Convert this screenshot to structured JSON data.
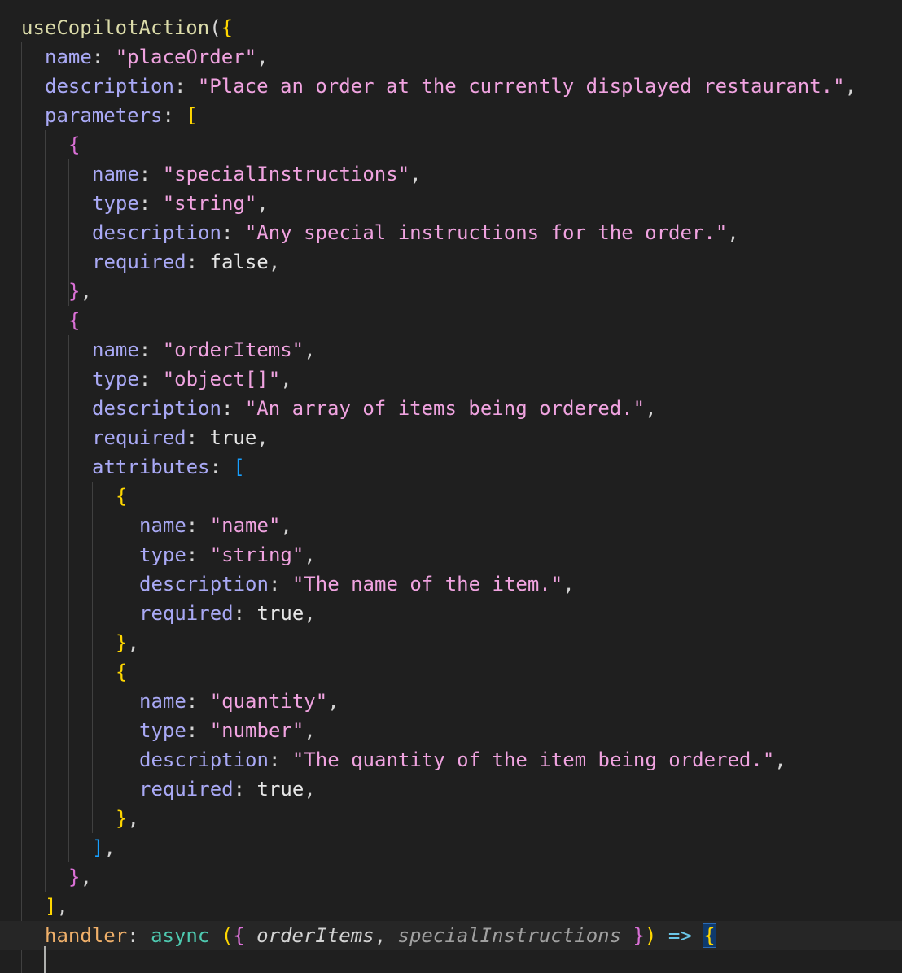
{
  "lines": [
    {
      "text": "useCopilotAction({"
    },
    {
      "text": "name: \"placeOrder\","
    },
    {
      "text": "description: \"Place an order at the currently displayed restaurant.\","
    },
    {
      "text": "parameters: ["
    },
    {
      "text": "{"
    },
    {
      "text": "name: \"specialInstructions\","
    },
    {
      "text": "type: \"string\","
    },
    {
      "text": "description: \"Any special instructions for the order.\","
    },
    {
      "text": "required: false,"
    },
    {
      "text": "},"
    },
    {
      "text": "{"
    },
    {
      "text": "name: \"orderItems\","
    },
    {
      "text": "type: \"object[]\","
    },
    {
      "text": "description: \"An array of items being ordered.\","
    },
    {
      "text": "required: true,"
    },
    {
      "text": "attributes: ["
    },
    {
      "text": "{"
    },
    {
      "text": "name: \"name\","
    },
    {
      "text": "type: \"string\","
    },
    {
      "text": "description: \"The name of the item.\","
    },
    {
      "text": "required: true,"
    },
    {
      "text": "},"
    },
    {
      "text": "{"
    },
    {
      "text": "name: \"quantity\","
    },
    {
      "text": "type: \"number\","
    },
    {
      "text": "description: \"The quantity of the item being ordered.\","
    },
    {
      "text": "required: true,"
    },
    {
      "text": "},"
    },
    {
      "text": "],"
    },
    {
      "text": "},"
    },
    {
      "text": "],"
    },
    {
      "text": "handler: async ({ orderItems, specialInstructions }) => {"
    }
  ],
  "tokens": {
    "fn_name": "useCopilotAction",
    "k_name": "name",
    "k_description": "description",
    "k_parameters": "parameters",
    "k_type": "type",
    "k_required": "required",
    "k_attributes": "attributes",
    "k_handler": "handler",
    "kw_async": "async",
    "v_false": "false",
    "v_true": "true",
    "s_placeOrder": "\"placeOrder\"",
    "s_place_desc": "\"Place an order at the currently displayed restaurant.\"",
    "s_specialInstructions": "\"specialInstructions\"",
    "s_string": "\"string\"",
    "s_special_desc": "\"Any special instructions for the order.\"",
    "s_orderItems": "\"orderItems\"",
    "s_object_arr": "\"object[]\"",
    "s_items_desc": "\"An array of items being ordered.\"",
    "s_name": "\"name\"",
    "s_name_desc": "\"The name of the item.\"",
    "s_quantity": "\"quantity\"",
    "s_number": "\"number\"",
    "s_quantity_desc": "\"The quantity of the item being ordered.\"",
    "p_orderItems": "orderItems",
    "p_specialInstructions": "specialInstructions"
  },
  "colors": {
    "background": "#1f1f1f",
    "function": "#dcdcaa",
    "property": "#a9a9f5",
    "string": "#f0a3e0",
    "keyword": "#4ec9b0",
    "bracket_level_1": "#ffd700",
    "bracket_level_2": "#da70d6",
    "bracket_level_3": "#179fff"
  }
}
